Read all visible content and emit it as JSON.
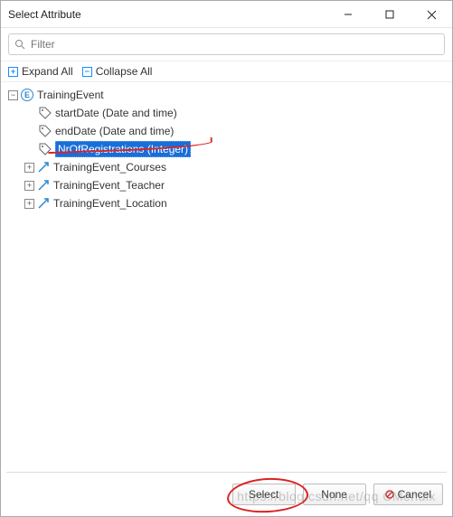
{
  "window": {
    "title": "Select Attribute"
  },
  "filter": {
    "placeholder": "Filter"
  },
  "toolbar": {
    "expand_label": "Expand All",
    "collapse_label": "Collapse All"
  },
  "tree": {
    "root": {
      "label": "TrainingEvent",
      "expanded": true,
      "attributes": [
        {
          "label": "startDate (Date and time)",
          "selected": false
        },
        {
          "label": "endDate (Date and time)",
          "selected": false
        },
        {
          "label": "NrOfRegistrations (Integer)",
          "selected": true
        }
      ],
      "associations": [
        {
          "label": "TrainingEvent_Courses",
          "expanded": false
        },
        {
          "label": "TrainingEvent_Teacher",
          "expanded": false
        },
        {
          "label": "TrainingEvent_Location",
          "expanded": false
        }
      ]
    }
  },
  "buttons": {
    "select": "Select",
    "none": "None",
    "cancel": "Cancel"
  },
  "watermark": "https://blog.csdn.net/qq     CMendix"
}
